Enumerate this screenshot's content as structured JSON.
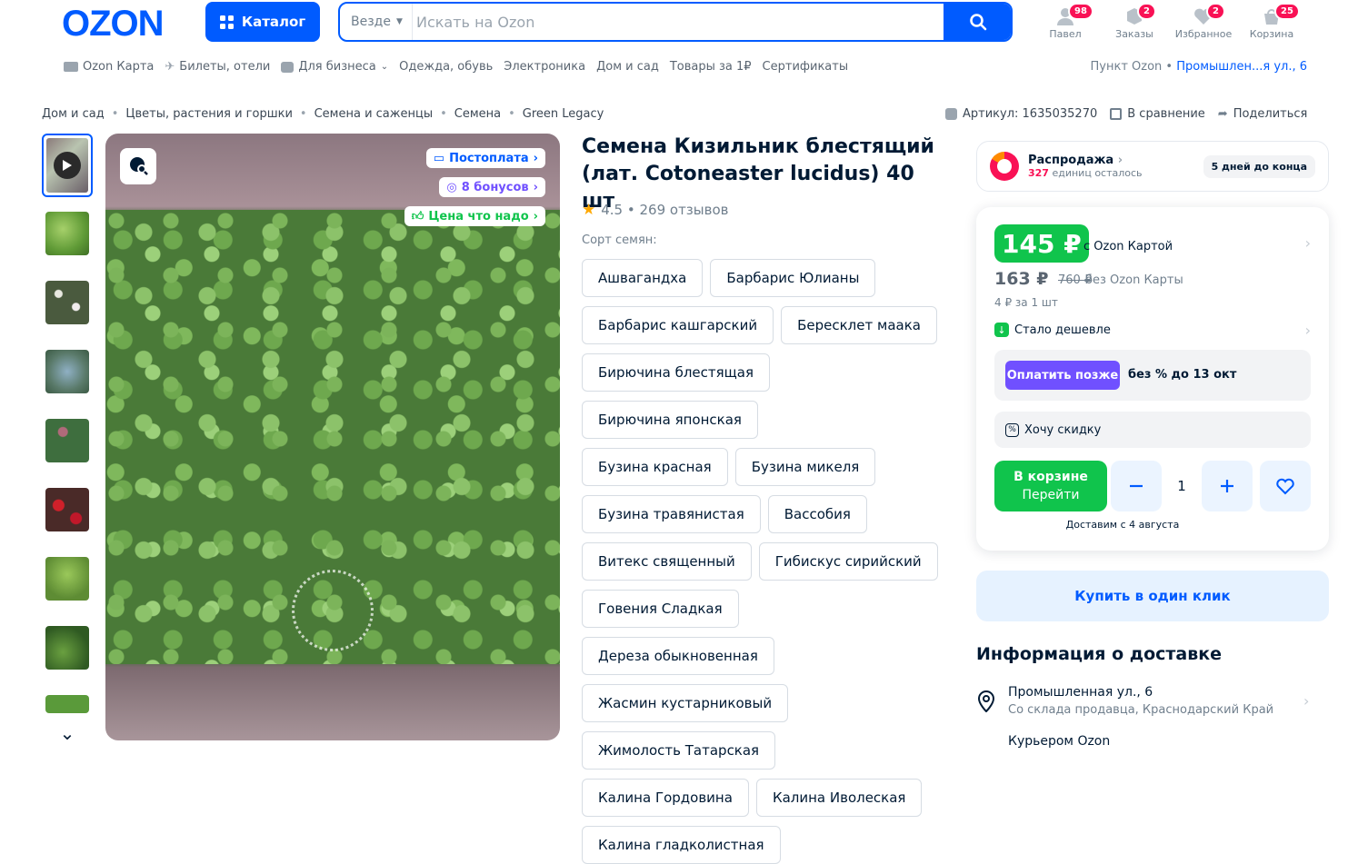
{
  "header": {
    "logo": "OZON",
    "catalog_label": "Каталог",
    "search_scope": "Везде",
    "search_placeholder": "Искать на Ozon",
    "profile": {
      "label": "Павел",
      "badge": "98"
    },
    "orders": {
      "label": "Заказы",
      "badge": "2"
    },
    "favorites": {
      "label": "Избранное",
      "badge": "2"
    },
    "cart": {
      "label": "Корзина",
      "badge": "25"
    }
  },
  "subnav": {
    "items": [
      "Ozon Карта",
      "Билеты, отели",
      "Для бизнеса",
      "Одежда, обувь",
      "Электроника",
      "Дом и сад",
      "Товары за 1₽",
      "Сертификаты"
    ],
    "pickup_prefix": "Пункт Ozon •",
    "pickup_address": "Промышлен...я ул., 6"
  },
  "breadcrumbs": [
    "Дом и сад",
    "Цветы, растения и горшки",
    "Семена и саженцы",
    "Семена",
    "Green Legacy"
  ],
  "article": {
    "label": "Артикул: 1635035270",
    "compare": "В сравнение",
    "share": "Поделиться"
  },
  "image": {
    "badges": [
      "Постоплата",
      "8 бонусов",
      "Цена что надо"
    ]
  },
  "product": {
    "title": "Семена Кизильник блестящий (лат. Cotoneaster lucidus) 40 шт",
    "rating": "4.5 • 269 отзывов",
    "variant_label": "Сорт семян:",
    "variants": [
      "Ашвагандха",
      "Барбарис Юлианы",
      "Барбарис кашгарский",
      "Бересклет маака",
      "Бирючина блестящая",
      "Бирючина японская",
      "Бузина красная",
      "Бузина микеля",
      "Бузина травянистая",
      "Вассобия",
      "Витекс священный",
      "Гибискус сирийский",
      "Говения Сладкая",
      "Дереза обыкновенная",
      "Жасмин кустарниковый",
      "Жимолость Татарская",
      "Калина Гордовина",
      "Калина Иволеская",
      "Калина гладколистная"
    ]
  },
  "sale": {
    "title": "Распродажа",
    "left_count": "327",
    "left_text": "единиц осталось",
    "days": "5 дней до конца"
  },
  "price": {
    "card_price": "145 ₽",
    "card_label": "с Ozon Картой",
    "regular": "163 ₽",
    "old": "760 ₽",
    "regular_label": "без Ozon Карты",
    "unit": "4 ₽ за 1 шт",
    "cheaper": "Стало дешевле",
    "pay_later_btn": "Оплатить позже",
    "pay_later_text": "без % до 13 окт",
    "want_discount": "Хочу скидку",
    "incart_line1": "В корзине",
    "incart_line2": "Перейти",
    "qty": "1",
    "delivery": "Доставим с 4 августа"
  },
  "buy_one_click": "Купить в один клик",
  "delivery": {
    "heading": "Информация о доставке",
    "address": "Промышленная ул., 6",
    "from": "Со склада продавца, Краснодарский Край",
    "courier": "Курьером Ozon"
  },
  "colors": {
    "brand": "#005bff",
    "green": "#10c44c",
    "pink": "#f91155",
    "purple": "#7050ff"
  }
}
